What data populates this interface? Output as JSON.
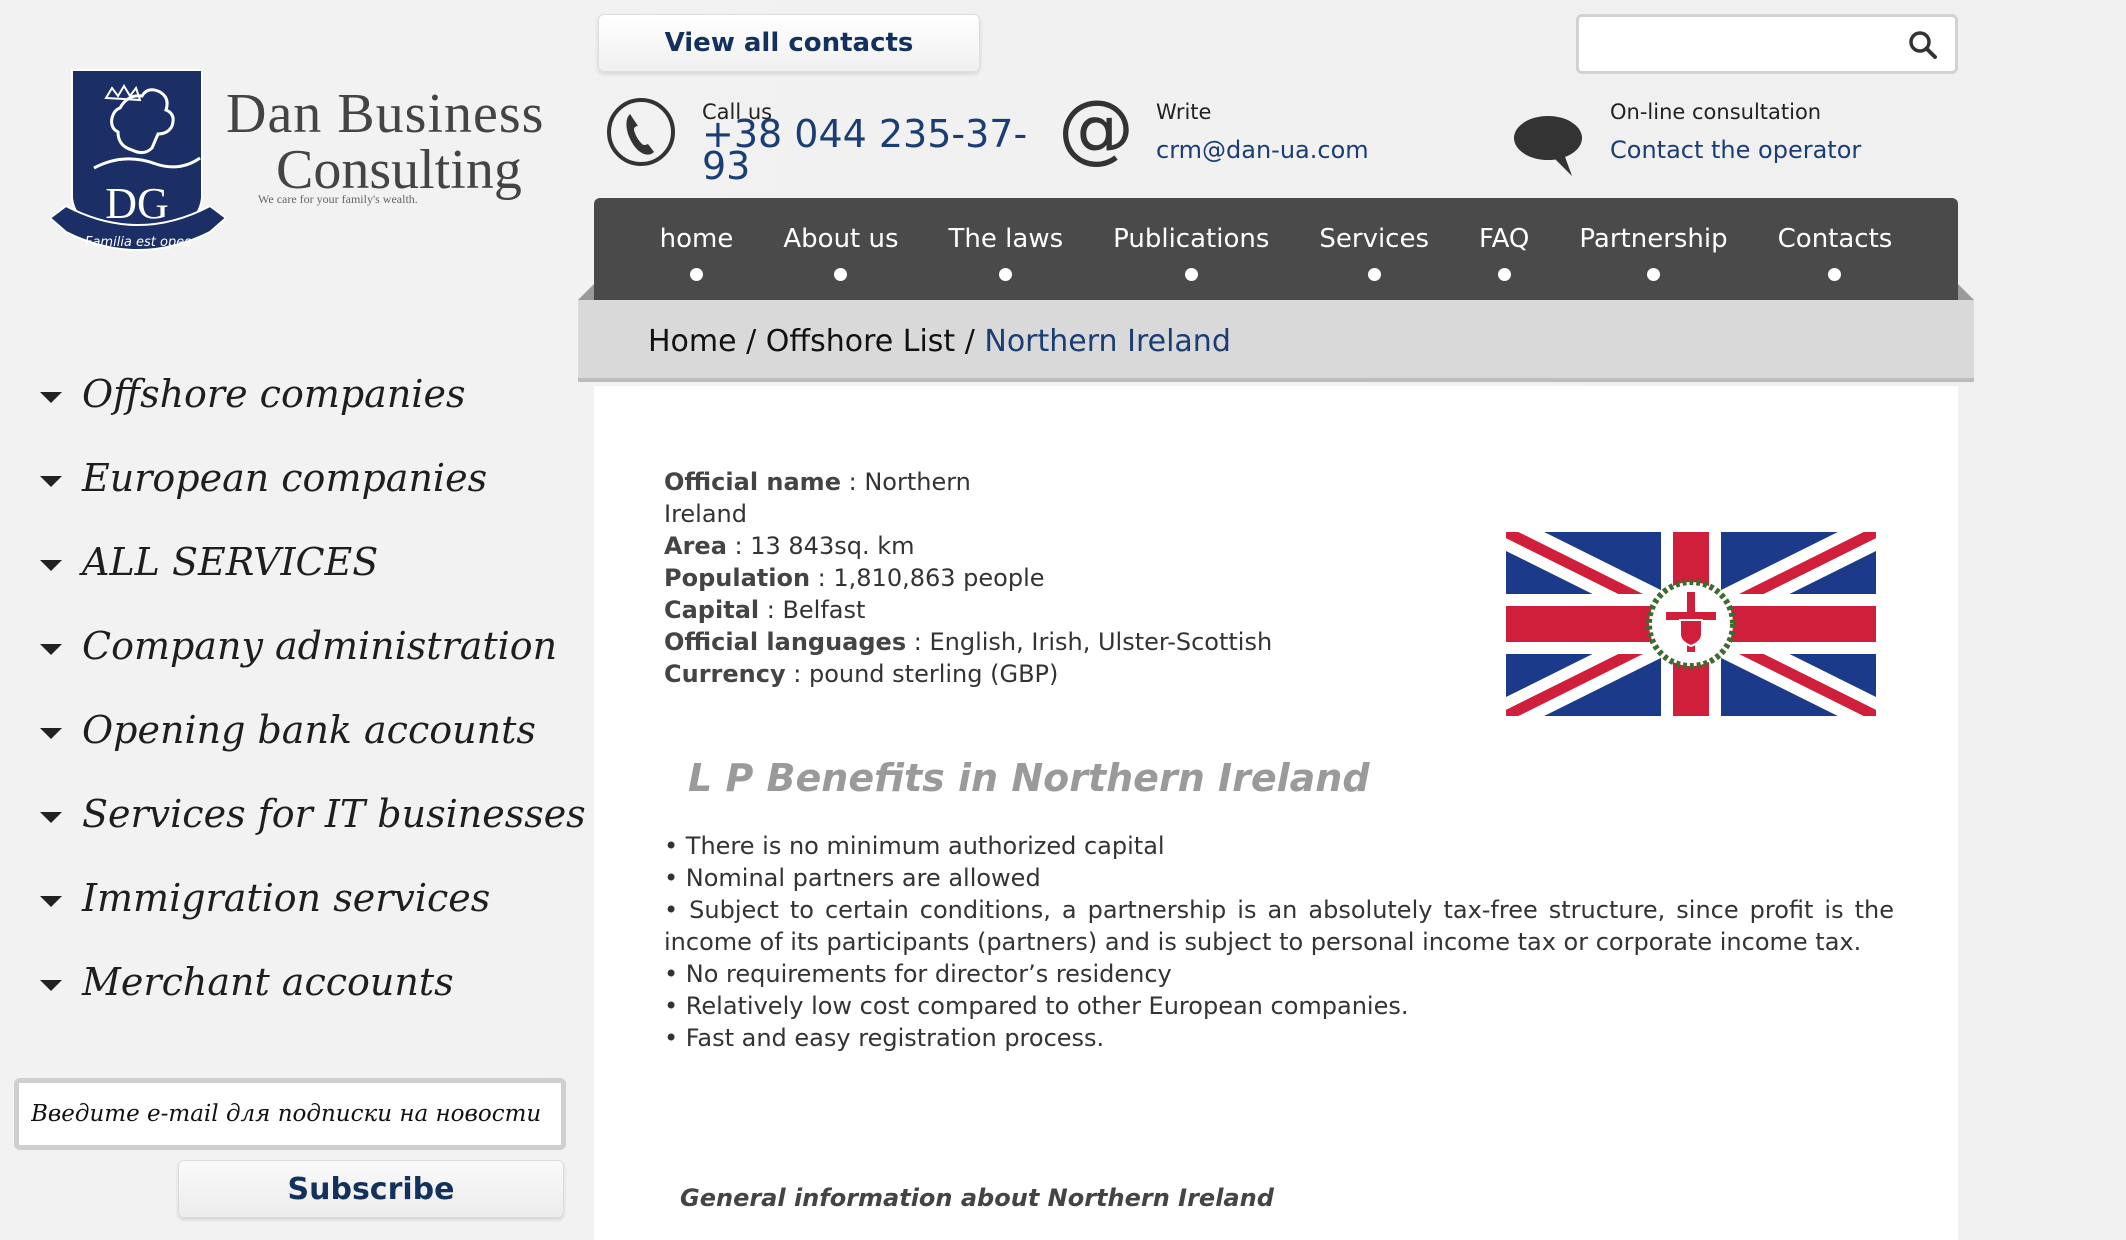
{
  "logo": {
    "monogram": "DG",
    "motto": "Familia est opes",
    "name_line1": "Dan Business",
    "name_line2": "Consulting",
    "tagline": "We care for your family's wealth."
  },
  "sidebar": {
    "items": [
      {
        "label": "Offshore companies"
      },
      {
        "label": "European companies"
      },
      {
        "label": "ALL SERVICES"
      },
      {
        "label": "Company administration"
      },
      {
        "label": "Opening bank accounts"
      },
      {
        "label": "Services for IT businesses"
      },
      {
        "label": "Immigration services"
      },
      {
        "label": "Merchant accounts"
      }
    ],
    "subscribe": {
      "placeholder": "Введите e-mail для подписки на новости",
      "button_label": "Subscribe"
    }
  },
  "header": {
    "view_contacts_label": "View all contacts",
    "search_placeholder": "",
    "call": {
      "caption": "Call us",
      "phone_line1": "+38 044 235-37-",
      "phone_line2": "93"
    },
    "write": {
      "caption": "Write",
      "email": "crm@dan-ua.com"
    },
    "chat": {
      "caption": "On-line consultation",
      "link": "Contact the operator"
    }
  },
  "nav": {
    "items": [
      {
        "label": "home"
      },
      {
        "label": "About us"
      },
      {
        "label": "The laws"
      },
      {
        "label": "Publications"
      },
      {
        "label": "Services"
      },
      {
        "label": "FAQ"
      },
      {
        "label": "Partnership"
      },
      {
        "label": "Contacts"
      }
    ]
  },
  "breadcrumb": {
    "home": "Home",
    "sep1": "/",
    "list": "Offshore List",
    "sep2": "/",
    "current": "Northern Ireland"
  },
  "facts": {
    "official_name": {
      "label": "Official name",
      "value": "Northern Ireland"
    },
    "area": {
      "label": "Area",
      "value": "13 843sq. km"
    },
    "population": {
      "label": "Population",
      "value": "1,810,863 people"
    },
    "capital": {
      "label": "Capital",
      "value": "Belfast"
    },
    "languages": {
      "label": "Official languages",
      "value": "English, Irish, Ulster-Scottish"
    },
    "currency": {
      "label": "Currency",
      "value": "pound sterling (GBP)"
    },
    "separator": " : "
  },
  "benefits": {
    "title": "L P Benefits in Northern Ireland",
    "items": [
      "• There is no minimum authorized capital",
      "• Nominal partners are allowed",
      "• Subject to certain conditions, a partnership is an absolutely tax-free structure, since profit is the income of its participants (partners) and is subject to personal income tax or corporate income tax.",
      "• No requirements for director’s residency",
      "• Relatively low cost compared to other European companies.",
      "• Fast and easy registration process."
    ]
  },
  "general_info_title": "General information about Northern Ireland",
  "colors": {
    "navy": "#13315c",
    "link_blue": "#1a3d73",
    "nav_bg": "#4a4a4a",
    "flag_blue": "#1b3a8a",
    "flag_red": "#cf1f3a"
  }
}
